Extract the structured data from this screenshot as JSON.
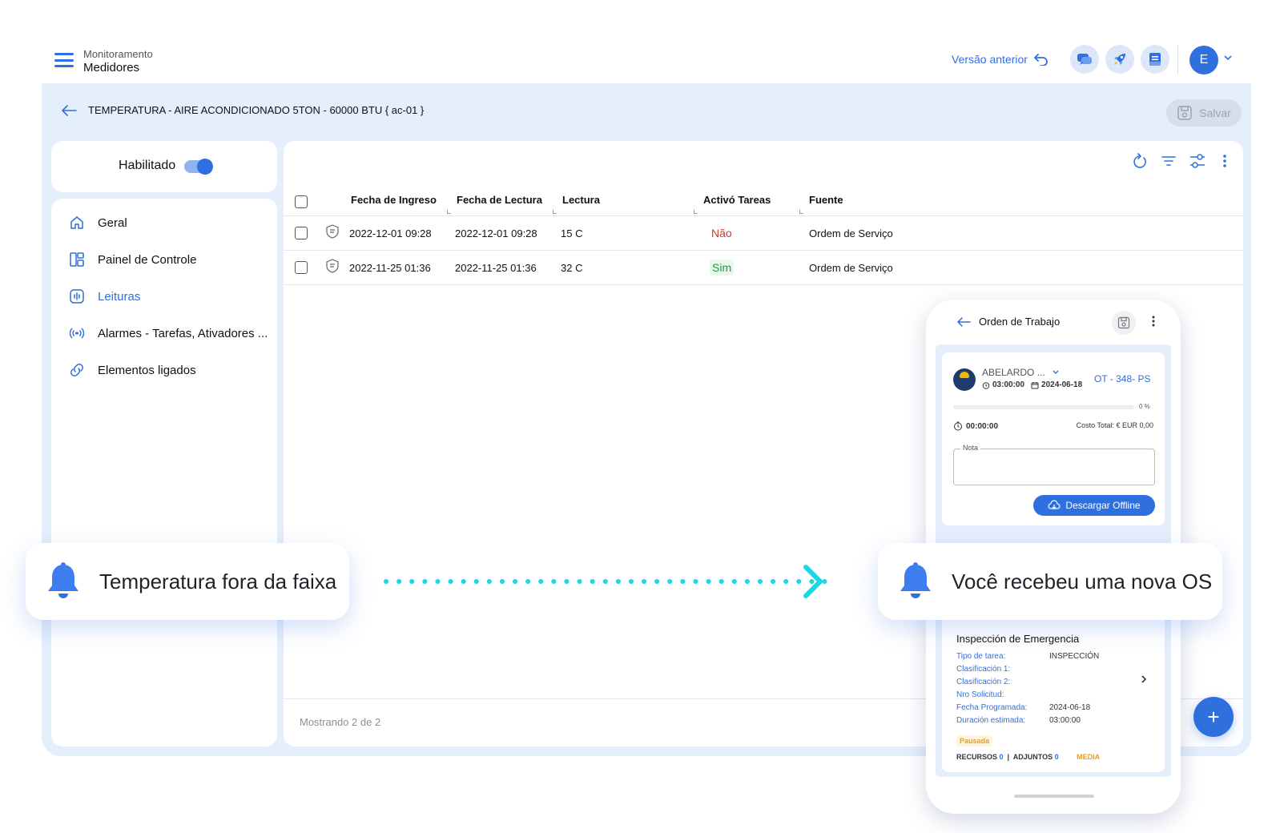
{
  "header": {
    "breadcrumb_top": "Monitoramento",
    "breadcrumb_main": "Medidores",
    "previous_version": "Versão anterior",
    "avatar_initial": "E"
  },
  "record": {
    "title": "TEMPERATURA - AIRE ACONDICIONADO 5TON - 60000 BTU { ac-01 }",
    "save_label": "Salvar"
  },
  "sidebar": {
    "enabled_label": "Habilitado",
    "enabled": true,
    "items": [
      {
        "label": "Geral",
        "icon": "home-icon"
      },
      {
        "label": "Painel de Controle",
        "icon": "dashboard-icon"
      },
      {
        "label": "Leituras",
        "icon": "readings-icon",
        "active": true
      },
      {
        "label": "Alarmes - Tarefas, Ativadores ...",
        "icon": "broadcast-icon"
      },
      {
        "label": "Elementos ligados",
        "icon": "link-icon"
      }
    ]
  },
  "table": {
    "columns": [
      "Fecha de Ingreso",
      "Fecha de Lectura",
      "Lectura",
      "Activó Tareas",
      "Fuente"
    ],
    "rows": [
      {
        "ingreso": "2022-12-01 09:28",
        "lectura_fecha": "2022-12-01 09:28",
        "lectura": "15 C",
        "activo": "Não",
        "fuente": "Ordem de Serviço"
      },
      {
        "ingreso": "2022-11-25 01:36",
        "lectura_fecha": "2022-11-25 01:36",
        "lectura": "32 C",
        "activo": "Sim",
        "fuente": "Ordem de Serviço"
      }
    ],
    "footer": "Mostrando 2 de 2"
  },
  "fab_label": "+",
  "phone": {
    "title": "Orden de Trabajo",
    "assignee": "ABELARDO ...",
    "duration": "03:00:00",
    "date": "2024-06-18",
    "ot_code": "OT - 348- PS",
    "progress_label": "0 %",
    "progress": 0,
    "timer": "00:00:00",
    "cost": "Costo Total: € EUR 0,00",
    "note_label": "Nota",
    "download_label": "Descargar Offline",
    "task_title": "Inspección de Emergencia",
    "fields": [
      {
        "label": "Tipo de tarea:",
        "value": "INSPECCIÓN"
      },
      {
        "label": "Clasificación 1:",
        "value": ""
      },
      {
        "label": "Clasificación 2:",
        "value": ""
      },
      {
        "label": "Nro Solicitud:",
        "value": ""
      },
      {
        "label": "Fecha Programada:",
        "value": "2024-06-18"
      },
      {
        "label": "Duración estimada:",
        "value": "03:00:00"
      }
    ],
    "status": "Pausada",
    "resources_label": "RECURSOS",
    "resources_count": "0",
    "attachments_label": "ADJUNTOS",
    "attachments_count": "0",
    "priority": "MEDIA"
  },
  "notifications": {
    "left": "Temperatura fora da faixa",
    "right": "Você recebeu uma nova OS"
  },
  "colors": {
    "accent": "#2f6fde",
    "frame_bg": "#e5eefb",
    "arrow": "#18d8e6",
    "negative": "#d33a2c",
    "positive": "#1b9e42"
  }
}
